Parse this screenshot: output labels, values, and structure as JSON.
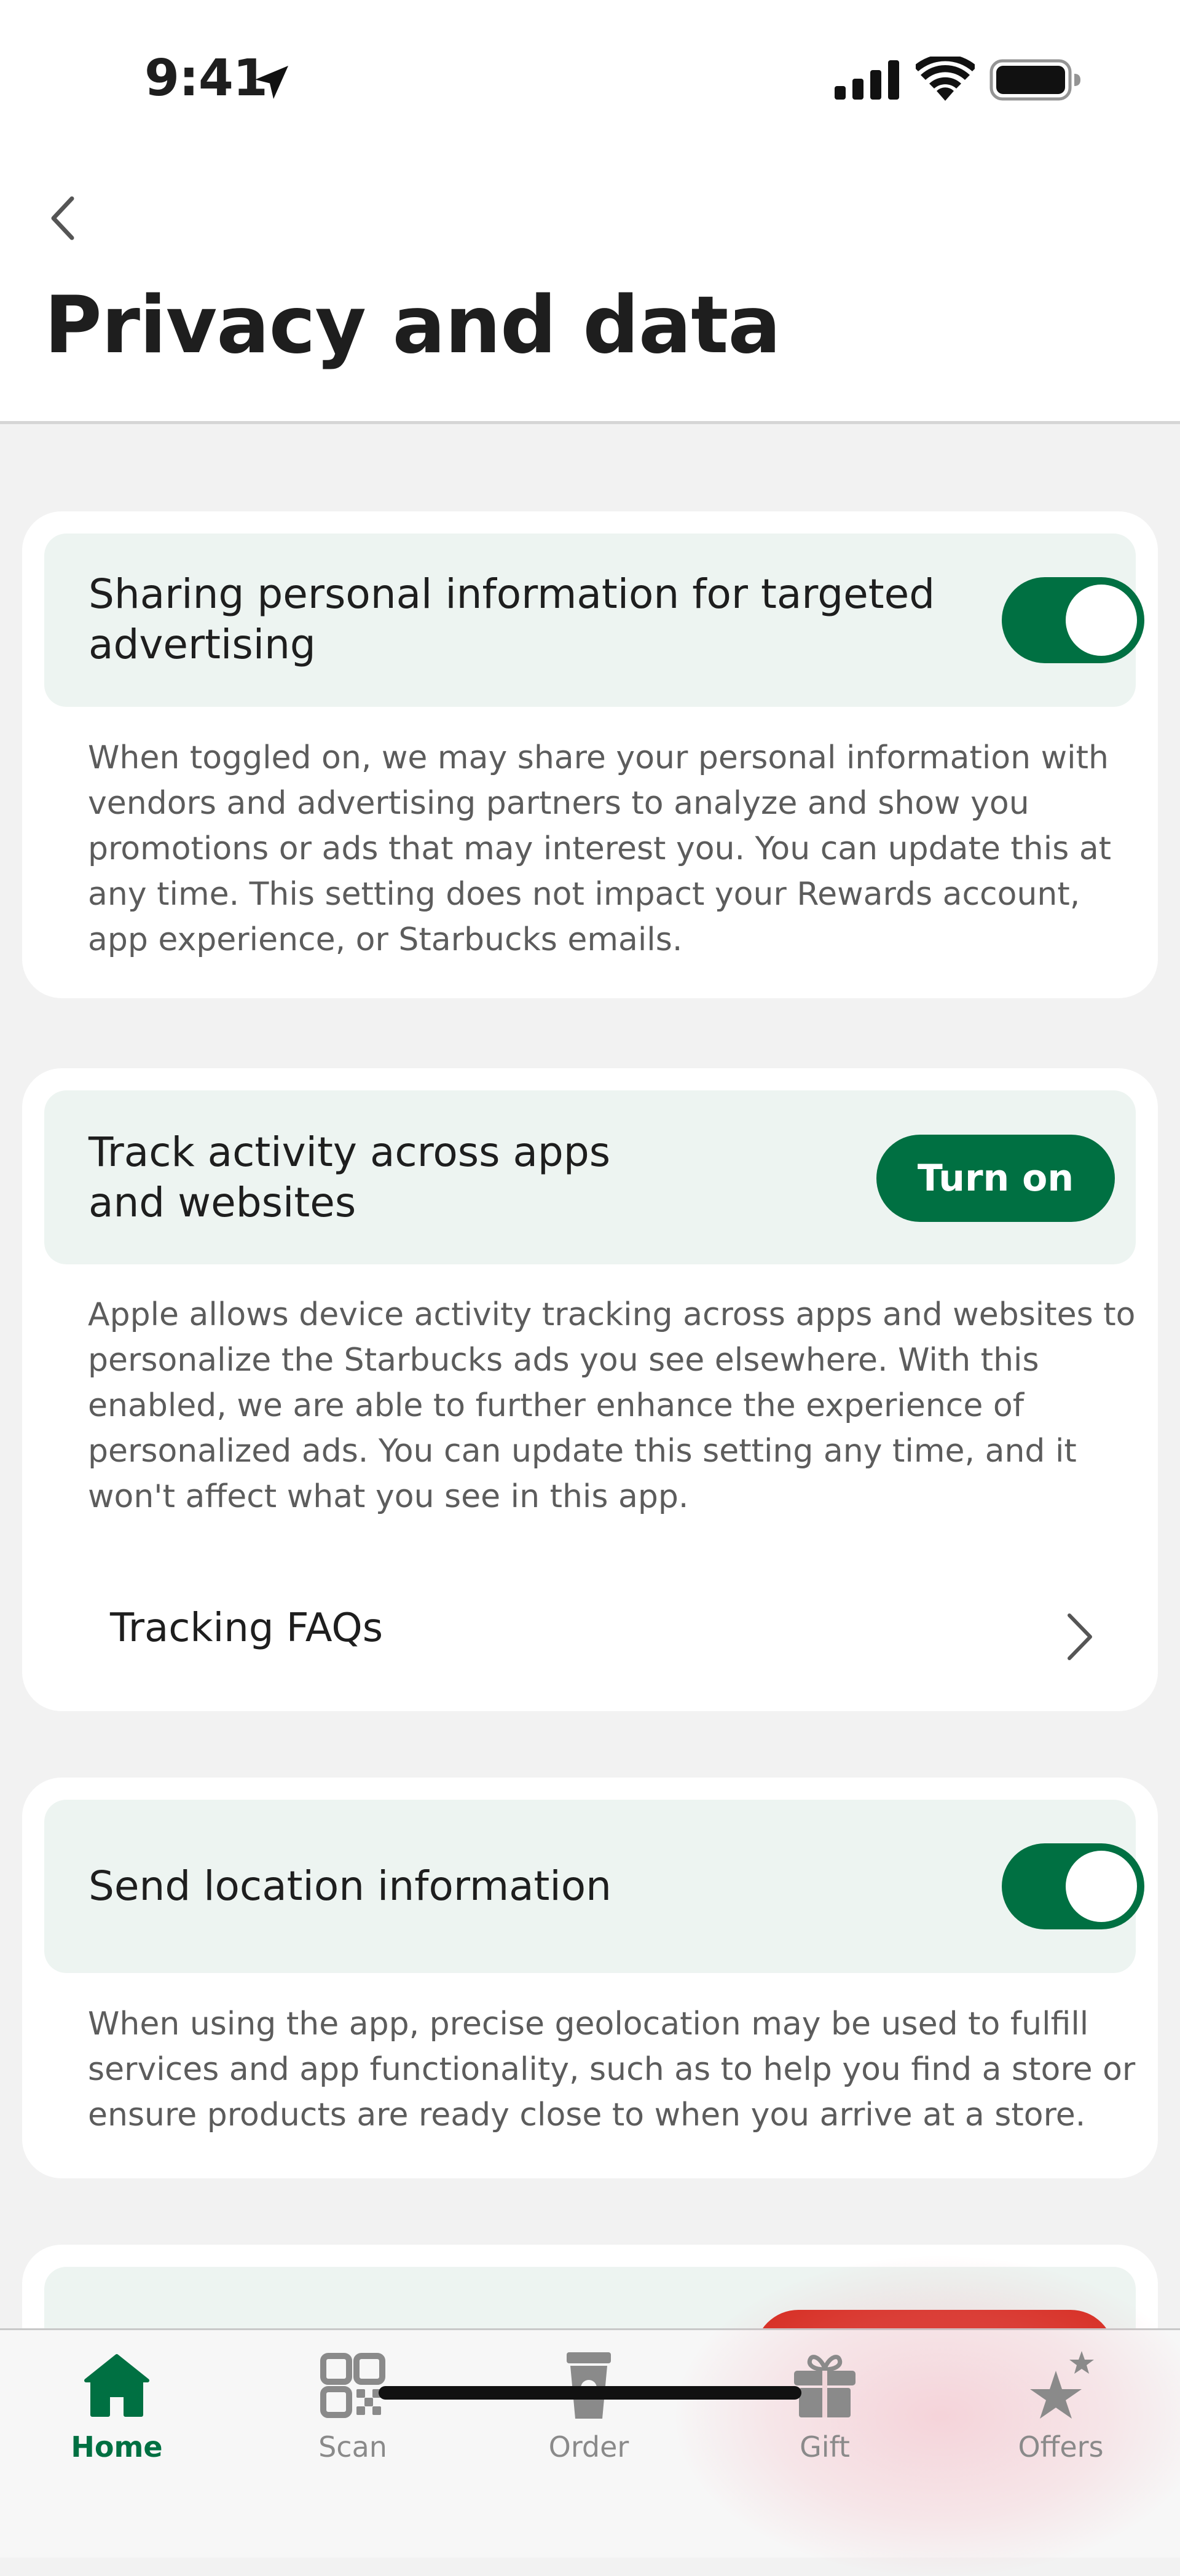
{
  "status_bar": {
    "time": "9:41"
  },
  "header": {
    "title": "Privacy and data"
  },
  "cards": [
    {
      "title_line1": "Sharing personal information for targeted",
      "title_line2": "advertising",
      "toggle_on": true,
      "description": "When toggled on, we may share your personal information with vendors and advertising partners to analyze and show you promotions or ads that may interest you. You can update this at any time. This setting does not impact your Rewards account, app experience, or Starbucks emails."
    },
    {
      "title_line1": "Track activity across apps",
      "title_line2": "and websites",
      "button_label": "Turn on",
      "description": "Apple allows device activity tracking across apps and websites to personalize the Starbucks ads you see elsewhere. With this enabled, we are able to further enhance the experience of personalized ads. You can update this setting any time, and it won't affect what you see in this app.",
      "link_label": "Tracking FAQs"
    },
    {
      "title": "Send location information",
      "toggle_on": true,
      "description": "When using the app, precise geolocation may be used to fulfill services and app functionality, such as to help you find a store or ensure products are ready close to when you arrive at a store."
    }
  ],
  "tabs": [
    {
      "label": "Home",
      "icon": "home-icon",
      "active": true
    },
    {
      "label": "Scan",
      "icon": "qr-code-icon",
      "active": false
    },
    {
      "label": "Order",
      "icon": "cup-icon",
      "active": false
    },
    {
      "label": "Gift",
      "icon": "gift-icon",
      "active": false
    },
    {
      "label": "Offers",
      "icon": "stars-icon",
      "active": false
    }
  ],
  "colors": {
    "brand_green": "#007042",
    "accent_red": "#d62b1f",
    "card_head_bg": "#edf4f1",
    "page_bg": "#f2f2f2"
  }
}
